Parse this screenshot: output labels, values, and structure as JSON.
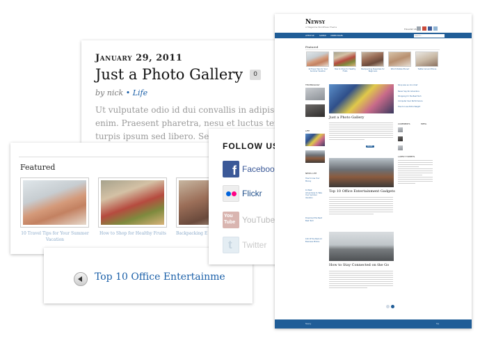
{
  "post": {
    "date": "January 29, 2011",
    "title": "Just a Photo Gallery",
    "comment_count": "0",
    "by_prefix": "by nick",
    "separator": "•",
    "category": "Life",
    "excerpt_lines": [
      "Ut vulputate odio id dui convallis in adipiscing libe",
      "enim. Praesent pharetra, nesu et luctus tempor,",
      "turpis ipsum sed libero. Sed sed"
    ]
  },
  "featured": {
    "heading": "Featured",
    "items": [
      {
        "caption": "10 Travel Tips for Your Summer Vacation"
      },
      {
        "caption": "How to Shop for Healthy Fruits"
      },
      {
        "caption": "Backpacking E"
      }
    ]
  },
  "nav": {
    "prev_title": "Top 10 Office Entertainme"
  },
  "follow": {
    "heading": "FOLLOW US",
    "items": [
      {
        "label": "Facebook",
        "color": "#3b5998"
      },
      {
        "label": "Flickr",
        "color": "#1f4f8a"
      },
      {
        "label": "YouTube",
        "color": "#bbbbbb"
      },
      {
        "label": "Twitter",
        "color": "#c9c9c9"
      }
    ]
  },
  "preview": {
    "logo": "Newsy",
    "tagline": "A Magazine WordPress Theme",
    "follow_text": "FOLLOW US:",
    "nav_items": [
      "LIFESTYLE",
      "SAMPLE",
      "UNDER PAGES"
    ],
    "search_placeholder": "Search...",
    "featured_heading": "Featured",
    "featured_captions": [
      "10 Travel Tips for Your Summer Vacation",
      "How to Shop for Healthy Fruits",
      "Backpacking Essentials for Beginners",
      "Which Mobile Phone?",
      "Twitter Around Phone"
    ],
    "section_technology": "TECHNOLOGY",
    "section_life": "LIFE",
    "section_news_lite": "NEWS LITE",
    "side_links": [
      "How to Use Your Money",
      "10 Best Adventures to Take Your Summer Vacation",
      "Download the Next Best Tech",
      "100 Of the Best Ad Business Photos"
    ],
    "article1_title": "Just a Photo Gallery",
    "more_label": "MORE",
    "article2_title": "Top 10 Office Entertainment Gadgets",
    "article3_title": "How to Stay Connected on the Go",
    "right_links": [
      "Shop Like an Iron Chef",
      "Never Say No Adventure",
      "Shopping for the Best Tech",
      "Computer User Performance",
      "How to Lose Extra Weight"
    ],
    "comments_label": "COMMENTS",
    "meta_label": "META",
    "latest_tweets_label": "LATEST TWEETS",
    "footer_left": "Newsy",
    "footer_right": "Top"
  }
}
